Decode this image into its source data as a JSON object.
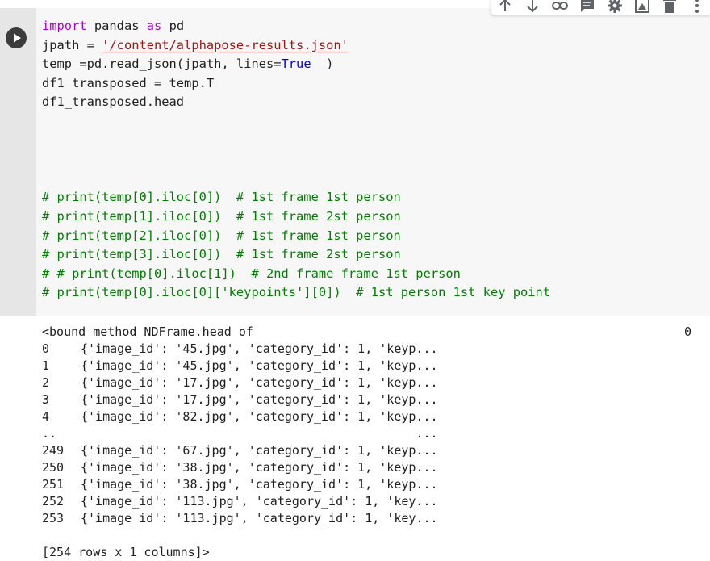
{
  "toolbar": {
    "icons": [
      "arrow-up-icon",
      "arrow-down-icon",
      "link-icon",
      "comment-icon",
      "gear-icon",
      "mirror-icon",
      "trash-icon",
      "more-icon"
    ]
  },
  "cell": {
    "code_lines": [
      {
        "kw": "import",
        "rest": " pandas ",
        "kw2": "as",
        "rest2": " pd"
      },
      {
        "pre": "jpath = ",
        "str": "'/content/alphapose-results.json'"
      },
      {
        "pre": "temp =pd.read_json(jpath, lines=",
        "bool": "True",
        "post": "  )"
      },
      {
        "pre": "df1_transposed = temp.T"
      },
      {
        "pre": "df1_transposed.head"
      },
      {
        "pre": ""
      },
      {
        "pre": ""
      },
      {
        "pre": ""
      },
      {
        "pre": ""
      },
      {
        "cm": "# print(temp[0].iloc[0])  # 1st frame 1st person"
      },
      {
        "cm": "# print(temp[1].iloc[0])  # 1st frame 2st person"
      },
      {
        "cm": "# print(temp[2].iloc[0])  # 1st frame 1st person"
      },
      {
        "cm": "# print(temp[3].iloc[0])  # 1st frame 2st person"
      },
      {
        "cm": "# # print(temp[0].iloc[1])  # 2nd frame frame 1st person"
      },
      {
        "cm": "# print(temp[0].iloc[0]['keypoints'][0])  # 1st person 1st key point"
      }
    ]
  },
  "output": {
    "header": "<bound method NDFrame.head of",
    "column_header": "0",
    "rows": [
      {
        "index": "0",
        "value": "{'image_id': '45.jpg', 'category_id': 1, 'keyp..."
      },
      {
        "index": "1",
        "value": "{'image_id': '45.jpg', 'category_id': 1, 'keyp..."
      },
      {
        "index": "2",
        "value": "{'image_id': '17.jpg', 'category_id': 1, 'keyp..."
      },
      {
        "index": "3",
        "value": "{'image_id': '17.jpg', 'category_id': 1, 'keyp..."
      },
      {
        "index": "4",
        "value": "{'image_id': '82.jpg', 'category_id': 1, 'keyp..."
      },
      {
        "index": "..",
        "value": "                                              ..."
      },
      {
        "index": "249",
        "value": "{'image_id': '67.jpg', 'category_id': 1, 'keyp..."
      },
      {
        "index": "250",
        "value": "{'image_id': '38.jpg', 'category_id': 1, 'keyp..."
      },
      {
        "index": "251",
        "value": "{'image_id': '38.jpg', 'category_id': 1, 'keyp..."
      },
      {
        "index": "252",
        "value": "{'image_id': '113.jpg', 'category_id': 1, 'key..."
      },
      {
        "index": "253",
        "value": "{'image_id': '113.jpg', 'category_id': 1, 'key..."
      }
    ],
    "blank": "",
    "footer": "[254 rows x 1 columns]>"
  }
}
